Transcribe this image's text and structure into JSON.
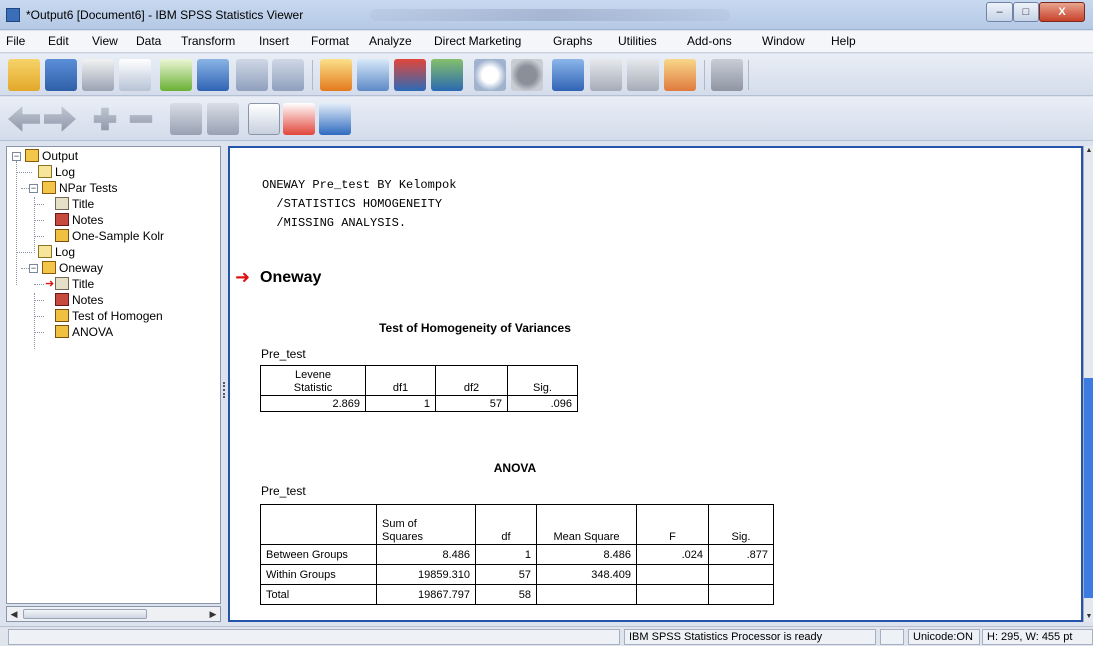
{
  "window": {
    "title": "*Output6 [Document6] - IBM SPSS Statistics Viewer"
  },
  "title_buttons": {
    "minimize": "–",
    "maximize": "□",
    "close": "X"
  },
  "menu": [
    "File",
    "Edit",
    "View",
    "Data",
    "Transform",
    "Insert",
    "Format",
    "Analyze",
    "Direct Marketing",
    "Graphs",
    "Utilities",
    "Add-ons",
    "Window",
    "Help"
  ],
  "toolbar1_icons": [
    "open-icon",
    "save-icon",
    "print-icon",
    "print-preview-icon",
    "export-icon",
    "recall-dialog-icon",
    "undo-icon",
    "redo-icon",
    "goto-case-icon",
    "goto-variable-icon",
    "variables-icon",
    "data-table-icon",
    "split-file-icon",
    "weight-cases-icon",
    "select-cases-icon",
    "value-labels-icon",
    "chart-builder-icon",
    "pivot-table-icon",
    "designate-window-icon",
    "script-icon"
  ],
  "toolbar2_icons": [
    "promote-icon",
    "demote-icon",
    "expand-icon",
    "collapse-icon",
    "show-icon",
    "hide-icon",
    "insert-heading-icon",
    "insert-title-icon",
    "insert-text-icon"
  ],
  "tree": {
    "output": "Output",
    "log1": "Log",
    "npar": "NPar Tests",
    "npar_title": "Title",
    "npar_notes": "Notes",
    "npar_ks": "One-Sample Kolr",
    "log2": "Log",
    "oneway": "Oneway",
    "oneway_title": "Title",
    "oneway_notes": "Notes",
    "oneway_homog": "Test of Homogen",
    "oneway_anova": "ANOVA"
  },
  "syntax": [
    "ONEWAY Pre_test BY Kelompok",
    "  /STATISTICS HOMOGENEITY",
    "  /MISSING ANALYSIS."
  ],
  "oneway_heading": "Oneway",
  "homogeneity": {
    "title": "Test of Homogeneity of Variances",
    "variable": "Pre_test",
    "headers": [
      "Levene\nStatistic",
      "df1",
      "df2",
      "Sig."
    ],
    "row": [
      "2.869",
      "1",
      "57",
      ".096"
    ]
  },
  "anova": {
    "title": "ANOVA",
    "variable": "Pre_test",
    "headers": [
      "",
      "Sum of\nSquares",
      "df",
      "Mean Square",
      "F",
      "Sig."
    ],
    "rows": [
      [
        "Between Groups",
        "8.486",
        "1",
        "8.486",
        ".024",
        ".877"
      ],
      [
        "Within Groups",
        "19859.310",
        "57",
        "348.409",
        "",
        ""
      ],
      [
        "Total",
        "19867.797",
        "58",
        "",
        "",
        ""
      ]
    ]
  },
  "status": {
    "processor": "IBM SPSS Statistics Processor is ready",
    "unicode": "Unicode:ON",
    "dims": "H: 295, W: 455 pt"
  },
  "colors": {
    "accent": "#2255aa",
    "arrow": "#e01010",
    "scroll_thumb": "#3c7be0"
  }
}
